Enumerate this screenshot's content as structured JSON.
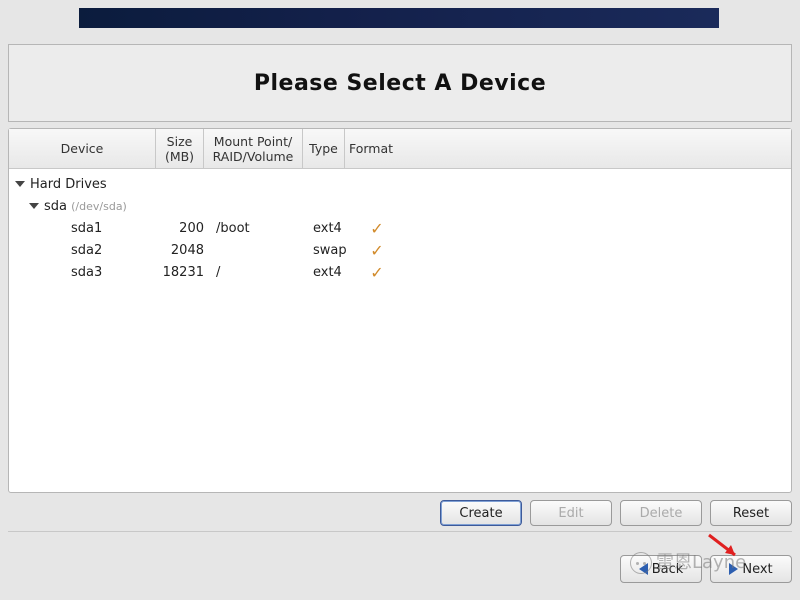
{
  "title": "Please Select A Device",
  "columns": {
    "device": "Device",
    "size_l1": "Size",
    "size_l2": "(MB)",
    "mount_l1": "Mount Point/",
    "mount_l2": "RAID/Volume",
    "type": "Type",
    "format": "Format"
  },
  "tree": {
    "group_label": "Hard Drives",
    "disk_label": "sda",
    "disk_path": "(/dev/sda)",
    "partitions": [
      {
        "name": "sda1",
        "size": "200",
        "mount": "/boot",
        "type": "ext4",
        "format": true
      },
      {
        "name": "sda2",
        "size": "2048",
        "mount": "",
        "type": "swap",
        "format": true
      },
      {
        "name": "sda3",
        "size": "18231",
        "mount": "/",
        "type": "ext4",
        "format": true
      }
    ]
  },
  "buttons": {
    "create": "Create",
    "edit": "Edit",
    "delete": "Delete",
    "reset": "Reset",
    "back": "Back",
    "next": "Next"
  },
  "watermark": "雷恩Layne"
}
